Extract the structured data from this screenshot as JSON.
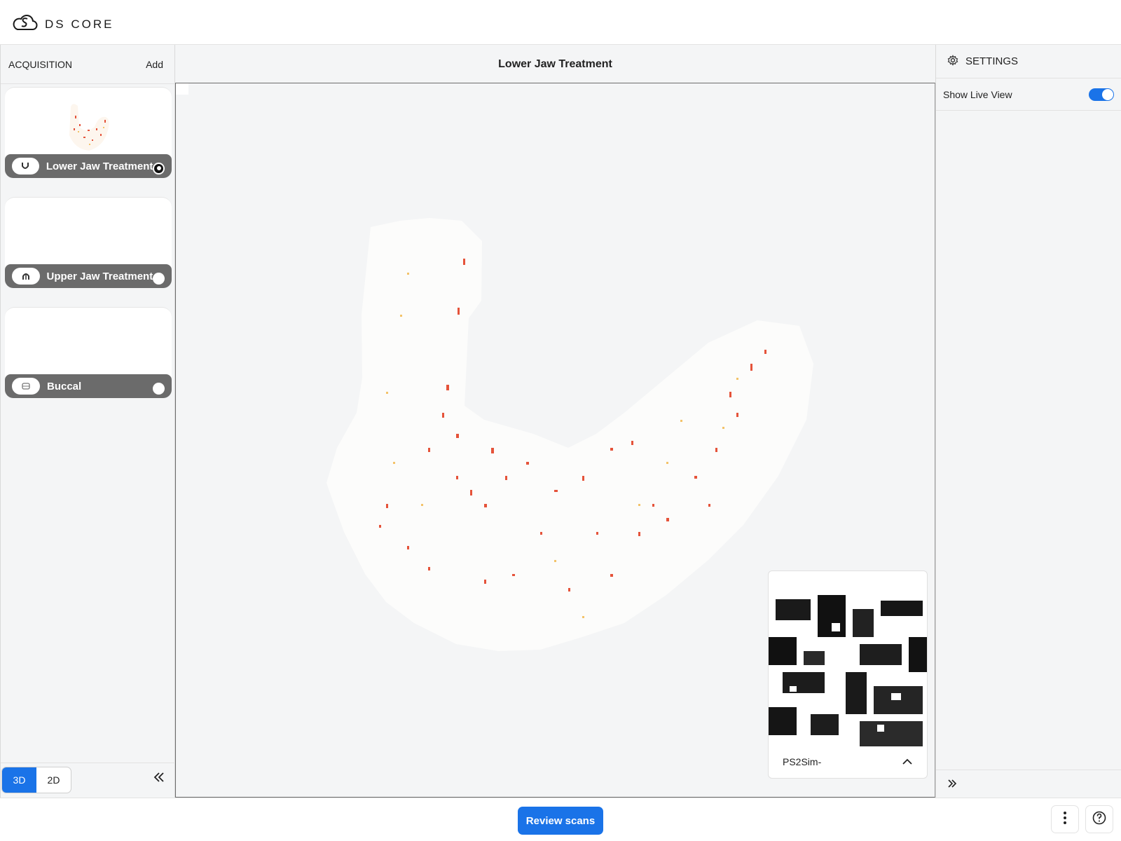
{
  "header": {
    "brand": "DS CORE"
  },
  "acquisition": {
    "title": "ACQUISITION",
    "add_label": "Add",
    "scans": [
      {
        "label": "Lower Jaw Treatment",
        "selected": true,
        "icon": "lower-jaw-icon"
      },
      {
        "label": "Upper Jaw Treatment",
        "selected": false,
        "icon": "upper-jaw-icon"
      },
      {
        "label": "Buccal",
        "selected": false,
        "icon": "buccal-icon"
      }
    ],
    "view_modes": [
      "3D",
      "2D"
    ],
    "active_view_mode": "3D"
  },
  "viewport": {
    "title": "Lower Jaw Treatment"
  },
  "live_view": {
    "device_name": "PS2Sim-"
  },
  "settings": {
    "title": "SETTINGS",
    "show_live_view_label": "Show Live View",
    "show_live_view_enabled": true
  },
  "footer": {
    "review_label": "Review scans"
  },
  "colors": {
    "accent": "#1a73e8",
    "scan_red": "#e5533a",
    "scan_yellow": "#f3c36a",
    "card_bar": "#6b6b6b"
  }
}
